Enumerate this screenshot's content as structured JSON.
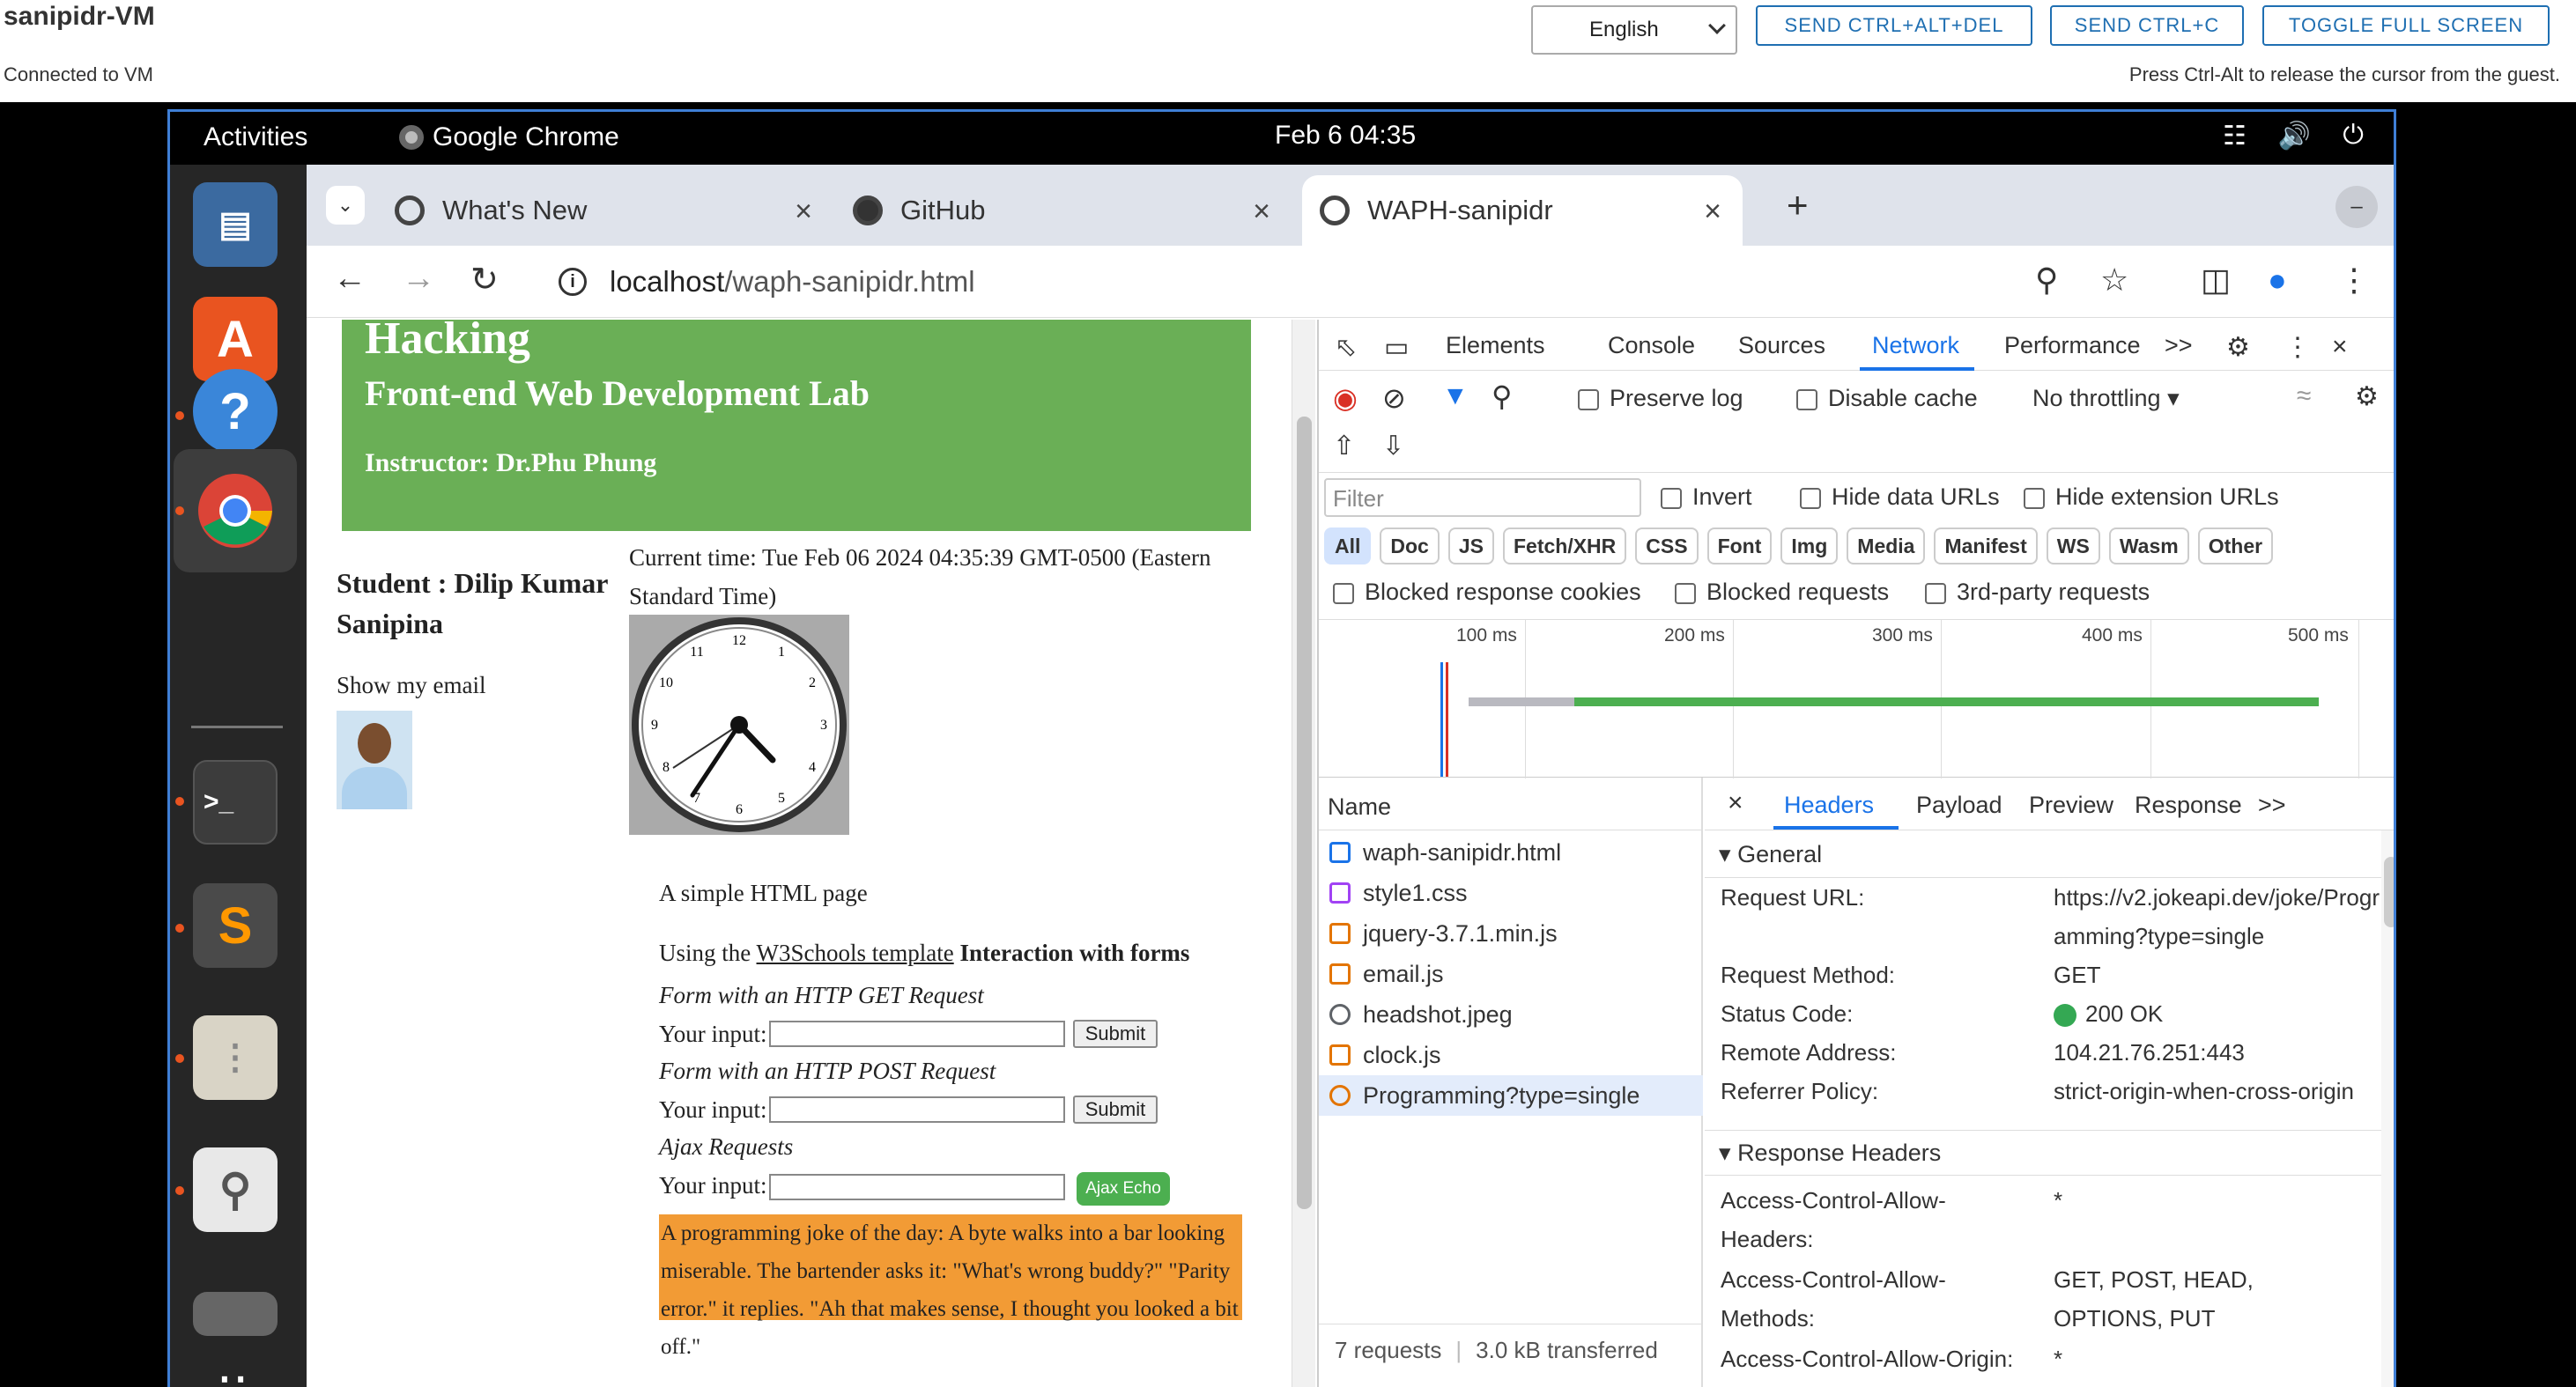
{
  "vm": {
    "title": "sanipidr-VM",
    "status": "Connected to VM",
    "hint": "Press Ctrl-Alt to release the cursor from the guest.",
    "language": "English",
    "buttons": [
      "SEND CTRL+ALT+DEL",
      "SEND CTRL+C",
      "TOGGLE FULL SCREEN"
    ]
  },
  "topbar": {
    "activities": "Activities",
    "app": "Google Chrome",
    "clock": "Feb 6  04:35",
    "tray_icons": [
      "network-icon",
      "volume-icon",
      "power-icon"
    ]
  },
  "dock": [
    "files-app-icon",
    "app-center-icon",
    "help-icon",
    "chrome-icon",
    "terminal-icon",
    "sublime-text-icon",
    "archive-icon",
    "image-viewer-icon",
    "drive-icon",
    "app-grid-icon"
  ],
  "browser": {
    "tabs": [
      {
        "label": "What's New"
      },
      {
        "label": "GitHub"
      },
      {
        "label": "WAPH-sanipidr"
      }
    ],
    "new_tab": "+",
    "url_host": "localhost",
    "url_path": "/waph-sanipidr.html"
  },
  "page": {
    "banner_title": "Hacking",
    "banner_subtitle": "Front-end Web Development Lab",
    "banner_instructor": "Instructor: Dr.Phu Phung",
    "student": "Student : Dilip Kumar Sanipina",
    "show_email": "Show my email",
    "current_time": "Current time: Tue Feb 06 2024 04:35:39 GMT-0500 (Eastern Standard Time)",
    "clock_numbers": [
      "12",
      "1",
      "2",
      "3",
      "4",
      "5",
      "6",
      "7",
      "8",
      "9",
      "10",
      "11"
    ],
    "simple": "A simple HTML page",
    "using_prefix": "Using the ",
    "using_link": "W3Schools template",
    "using_suffix": " Interaction with forms",
    "get_label": "Form with an HTTP GET Request",
    "post_label": "Form with an HTTP POST Request",
    "ajax_label": "Ajax Requests",
    "your_input": "Your input:",
    "submit": "Submit",
    "ajax_echo": "Ajax Echo",
    "joke": "A programming joke of the day: A byte walks into a bar looking miserable. The bartender asks it: \"What's wrong buddy?\" \"Parity error.\" it replies. \"Ah that makes sense, I thought you looked a bit off.\""
  },
  "devtools": {
    "tabs": [
      "Elements",
      "Console",
      "Sources",
      "Network",
      "Performance",
      ">>"
    ],
    "preserve_log": "Preserve log",
    "disable_cache": "Disable cache",
    "throttling": "No throttling",
    "filter_placeholder": "Filter",
    "invert": "Invert",
    "hide_data_urls": "Hide data URLs",
    "hide_extension_urls": "Hide extension URLs",
    "types": [
      "All",
      "Doc",
      "JS",
      "Fetch/XHR",
      "CSS",
      "Font",
      "Img",
      "Media",
      "Manifest",
      "WS",
      "Wasm",
      "Other"
    ],
    "blocked_cookies": "Blocked response cookies",
    "blocked_requests": "Blocked requests",
    "third_party": "3rd-party requests",
    "timeline_labels": [
      "100 ms",
      "200 ms",
      "300 ms",
      "400 ms",
      "500 ms"
    ],
    "name_header": "Name",
    "requests": [
      "waph-sanipidr.html",
      "style1.css",
      "jquery-3.7.1.min.js",
      "email.js",
      "headshot.jpeg",
      "clock.js",
      "Programming?type=single"
    ],
    "footer_requests": "7 requests",
    "footer_transferred": "3.0 kB transferred",
    "detail_tabs": [
      "Headers",
      "Payload",
      "Preview",
      "Response",
      ">>"
    ],
    "general": "General",
    "general_rows": [
      {
        "k": "Request URL:",
        "v": "https://v2.jokeapi.dev/joke/Programming?type=single"
      },
      {
        "k": "Request Method:",
        "v": "GET"
      },
      {
        "k": "Status Code:",
        "v": "200 OK"
      },
      {
        "k": "Remote Address:",
        "v": "104.21.76.251:443"
      },
      {
        "k": "Referrer Policy:",
        "v": "strict-origin-when-cross-origin"
      }
    ],
    "response_headers": "Response Headers",
    "resp_rows": [
      {
        "k": "Access-Control-Allow-Headers:",
        "v": "*"
      },
      {
        "k": "Access-Control-Allow-Methods:",
        "v": "GET, POST, HEAD, OPTIONS, PUT"
      },
      {
        "k": "Access-Control-Allow-Origin:",
        "v": "*"
      }
    ],
    "status_color": "#34a853"
  }
}
